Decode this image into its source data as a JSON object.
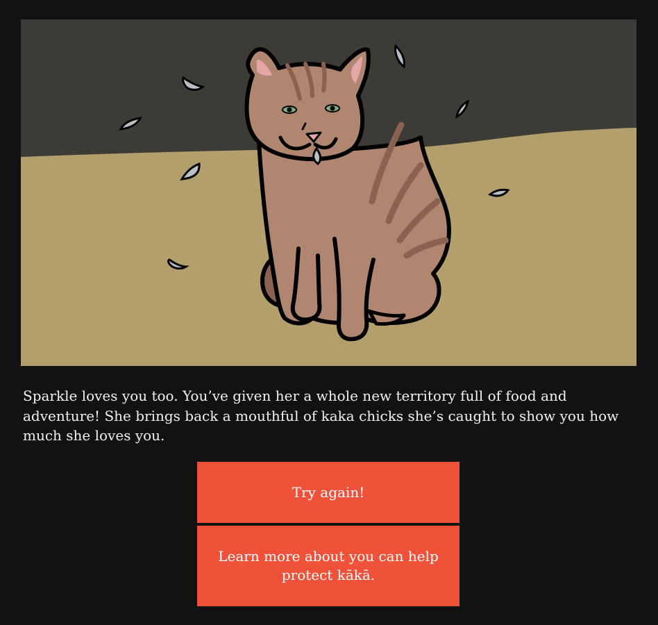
{
  "scene": {
    "image_icon": "cat-with-feathers-illustration",
    "colors": {
      "wall": "#3d3b36",
      "floor": "#b39f6b",
      "cat_body": "#b08670",
      "cat_stripes": "#8b6151",
      "outline": "#000000",
      "ear_inner": "#e6a6a8",
      "eyes": "#7fb07a",
      "feather": "#b8c0c4"
    }
  },
  "story": {
    "text": "Sparkle loves you too. You’ve given her a whole new territory full of food and adventure! She brings back a mouthful of kaka chicks she’s caught to show you how much she loves you."
  },
  "buttons": {
    "retry_label": "Try again!",
    "learn_label": "Learn more about you can help protect kākā."
  },
  "theme": {
    "background": "#121212",
    "button": "#ef5239",
    "text": "#f2f2f2"
  }
}
